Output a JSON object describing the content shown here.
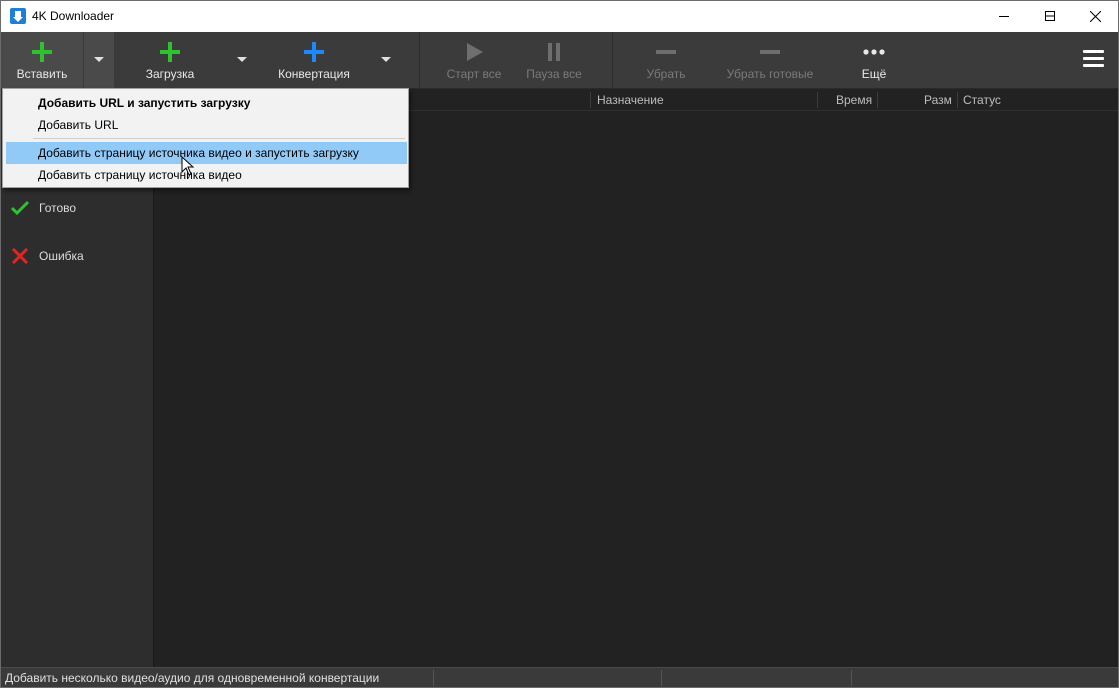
{
  "window": {
    "title": "4K Downloader"
  },
  "toolbar": {
    "paste_label": "Вставить",
    "download_label": "Загрузка",
    "convert_label": "Конвертация",
    "start_all_label": "Старт все",
    "pause_all_label": "Пауза все",
    "remove_label": "Убрать",
    "remove_done_label": "Убрать готовые",
    "more_label": "Ещё"
  },
  "paste_menu": {
    "items": [
      {
        "label": "Добавить URL и запустить загрузку"
      },
      {
        "label": "Добавить URL"
      },
      {
        "label": "Добавить страницу источника видео и запустить загрузку"
      },
      {
        "label": "Добавить страницу источника видео"
      }
    ]
  },
  "sidebar": {
    "items": [
      {
        "label": "Готово",
        "icon": "check-icon",
        "color": "#2fc12f"
      },
      {
        "label": "Ошибка",
        "icon": "error-x-icon",
        "color": "#e02424"
      }
    ]
  },
  "list": {
    "columns": [
      "Назначение",
      "Время",
      "Разм",
      "Статус"
    ]
  },
  "statusbar": {
    "text": "Добавить несколько видео/аудио для одновременной конвертации"
  },
  "colors": {
    "accent_green": "#2fc12f",
    "accent_blue": "#1e88ff",
    "menu_highlight": "#91c9f7"
  }
}
